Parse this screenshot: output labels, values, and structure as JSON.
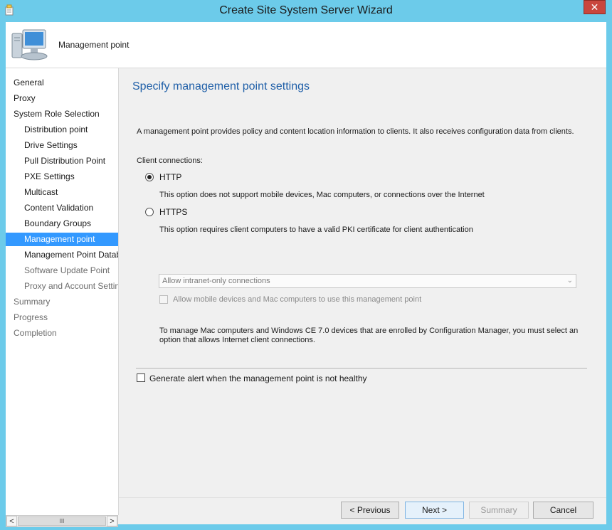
{
  "window": {
    "title": "Create Site System Server Wizard",
    "close_glyph": "✕"
  },
  "header": {
    "title": "Management point",
    "icon": "computer-monitor-icon"
  },
  "nav": {
    "items": [
      {
        "label": "General",
        "indent": 0,
        "state": "normal"
      },
      {
        "label": "Proxy",
        "indent": 0,
        "state": "normal"
      },
      {
        "label": "System Role Selection",
        "indent": 0,
        "state": "normal"
      },
      {
        "label": "Distribution point",
        "indent": 1,
        "state": "normal"
      },
      {
        "label": "Drive Settings",
        "indent": 1,
        "state": "normal"
      },
      {
        "label": "Pull Distribution Point",
        "indent": 1,
        "state": "normal"
      },
      {
        "label": "PXE Settings",
        "indent": 1,
        "state": "normal"
      },
      {
        "label": "Multicast",
        "indent": 1,
        "state": "normal"
      },
      {
        "label": "Content Validation",
        "indent": 1,
        "state": "normal"
      },
      {
        "label": "Boundary Groups",
        "indent": 1,
        "state": "normal"
      },
      {
        "label": "Management point",
        "indent": 1,
        "state": "active"
      },
      {
        "label": "Management Point Datab",
        "indent": 1,
        "state": "normal"
      },
      {
        "label": "Software Update Point",
        "indent": 1,
        "state": "disabled"
      },
      {
        "label": "Proxy and Account Settin",
        "indent": 1,
        "state": "disabled"
      },
      {
        "label": "Summary",
        "indent": 0,
        "state": "disabled"
      },
      {
        "label": "Progress",
        "indent": 0,
        "state": "disabled"
      },
      {
        "label": "Completion",
        "indent": 0,
        "state": "disabled"
      }
    ],
    "scroll_left": "<",
    "scroll_right": ">",
    "scroll_thumb": "III"
  },
  "main": {
    "heading": "Specify management point settings",
    "description": "A management point provides policy and content location information to clients.  It also receives configuration data from clients.",
    "client_connections_label": "Client connections:",
    "http": {
      "label": "HTTP",
      "selected": true,
      "note": "This option does not support mobile devices, Mac computers, or connections over the Internet"
    },
    "https": {
      "label": "HTTPS",
      "selected": false,
      "note": "This option requires client computers to have a valid PKI certificate for client authentication"
    },
    "connection_select": {
      "value": "Allow intranet-only connections",
      "enabled": false
    },
    "mobile_checkbox": {
      "label": "Allow mobile devices and Mac computers to use this management point",
      "checked": false,
      "enabled": false
    },
    "mac_note_line1": "To manage Mac computers and Windows CE 7.0 devices that are enrolled by Configuration Manager, you must select an",
    "mac_note_line2": "option that allows Internet client connections.",
    "alert_checkbox": {
      "label": "Generate alert when the management point is not healthy",
      "checked": false
    }
  },
  "buttons": {
    "previous": "< Previous",
    "next": "Next >",
    "summary": "Summary",
    "cancel": "Cancel"
  },
  "colors": {
    "title_bar": "#6ccbea",
    "accent_selection": "#3399ff",
    "heading": "#1f5fa8",
    "close_button": "#c9463d"
  }
}
